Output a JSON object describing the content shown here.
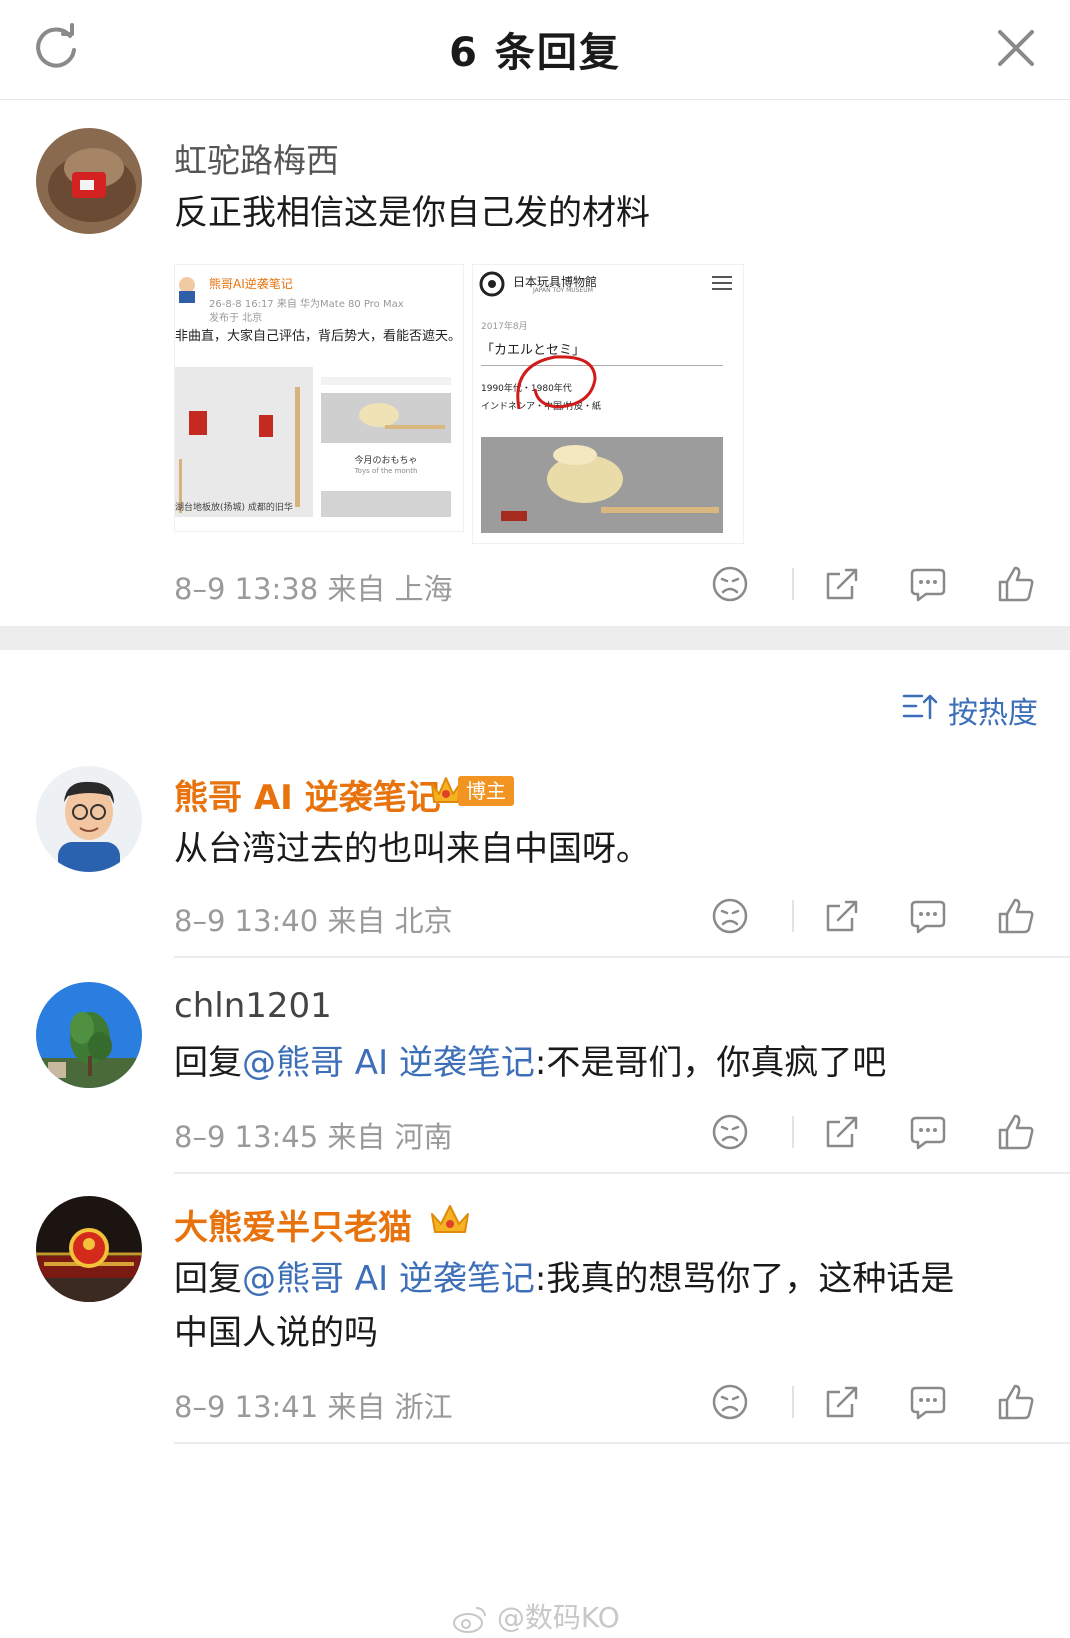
{
  "header": {
    "title": "6 条回复"
  },
  "main_comment": {
    "username": "虹驼路梅西",
    "text": "反正我相信这是你自己发的材料",
    "meta": "8–9 13:38 来自 上海",
    "thumb1": {
      "author": "熊哥AI逆袭笔记",
      "time": "26-8-8 16:17 来自 华为Mate 80 Pro Max",
      "loc": "发布于 北京",
      "body": "非曲直，大家自己评估，背后势大，看能否遮天。",
      "label1": "今月のおもちゃ",
      "label2": "Toys of the month",
      "caption": "湖台地板放(扬城)    成都的旧华"
    },
    "thumb2": {
      "museum": "日本玩具博物館",
      "museum_en": "JAPAN TOY MUSEUM",
      "date": "2017年8月",
      "name": "「カエルとセミ」",
      "era": "1990年代・1980年代",
      "origin": "インドネシア・中国/竹皮・紙"
    }
  },
  "sort": {
    "label": "按热度"
  },
  "replies": [
    {
      "username": "熊哥 AI 逆袭笔记",
      "badge": "博主",
      "text": "从台湾过去的也叫来自中国呀。",
      "meta": "8–9 13:40 来自 北京"
    },
    {
      "username": "chln1201",
      "reply_prefix": "回复",
      "mention": "@熊哥 AI 逆袭笔记",
      "text": ":不是哥们，你真疯了吧",
      "meta": "8–9 13:45 来自 河南"
    },
    {
      "username": "大熊爱半只老猫",
      "reply_prefix": "回复",
      "mention": "@熊哥 AI 逆袭笔记",
      "text_line1": ":我真的想骂你了，这种话是",
      "text_line2": "中国人说的吗",
      "meta": "8–9 13:41 来自 浙江"
    }
  ],
  "watermark": "@数码KO",
  "colors": {
    "vip_orange": "#e8720c",
    "link_blue": "#3d6fb8",
    "meta_gray": "#9a9a9a",
    "icon_gray": "#8a8a8a"
  }
}
